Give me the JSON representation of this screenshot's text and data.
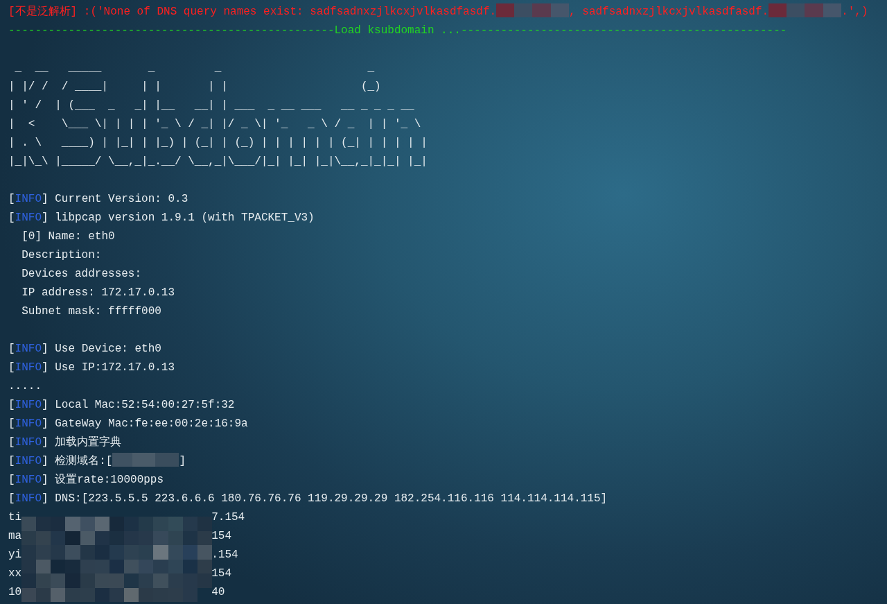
{
  "lines": [
    {
      "kind": "error",
      "segments": [
        {
          "kind": "text",
          "text": "[不是泛解析] :('None of DNS query names exist: sadfsadnxzjlkcxjvlkasdfasdf."
        },
        {
          "kind": "redaction"
        },
        {
          "kind": "text",
          "text": ", sadfsadnxzjlkcxjvlkasdfasdf."
        },
        {
          "kind": "redaction"
        },
        {
          "kind": "text",
          "text": ".',)"
        }
      ]
    },
    {
      "kind": "separator",
      "text": "-------------------------------------------------Load ksubdomain ...-------------------------------------------------"
    },
    {
      "kind": "blank"
    },
    {
      "kind": "ascii",
      "text": " _  __   _____       _         _                      _"
    },
    {
      "kind": "ascii",
      "text": "| |/ /  / ____|     | |       | |                    (_)"
    },
    {
      "kind": "ascii",
      "text": "| ' /  | (___  _   _| |__   __| | ___  _ __ ___   __ _ _ _ __"
    },
    {
      "kind": "ascii",
      "text": "|  <    \\___ \\| | | | '_ \\ / _| |/ _ \\| '_   _ \\ / _  | | '_ \\"
    },
    {
      "kind": "ascii",
      "text": "| . \\   ____) | |_| | |_) | (_| | (_) | | | | | | (_| | | | | |"
    },
    {
      "kind": "ascii",
      "text": "|_|\\_\\ |_____/ \\__,_|_.__/ \\__,_|\\___/|_| |_| |_|\\__,_|_|_| |_|"
    },
    {
      "kind": "blank"
    },
    {
      "kind": "info",
      "segments": [
        {
          "kind": "bracket",
          "text": "["
        },
        {
          "kind": "tag",
          "text": "INFO"
        },
        {
          "kind": "bracket",
          "text": "]"
        },
        {
          "kind": "text",
          "text": " Current Version: 0.3"
        }
      ]
    },
    {
      "kind": "info",
      "segments": [
        {
          "kind": "bracket",
          "text": "["
        },
        {
          "kind": "tag",
          "text": "INFO"
        },
        {
          "kind": "bracket",
          "text": "]"
        },
        {
          "kind": "text",
          "text": " libpcap version 1.9.1 (with TPACKET_V3)"
        }
      ]
    },
    {
      "kind": "plain",
      "text": "  [0] Name: eth0"
    },
    {
      "kind": "plain",
      "text": "  Description:"
    },
    {
      "kind": "plain",
      "text": "  Devices addresses:"
    },
    {
      "kind": "plain",
      "text": "  IP address: 172.17.0.13"
    },
    {
      "kind": "plain",
      "text": "  Subnet mask: fffff000"
    },
    {
      "kind": "blank"
    },
    {
      "kind": "info",
      "segments": [
        {
          "kind": "bracket",
          "text": "["
        },
        {
          "kind": "tag",
          "text": "INFO"
        },
        {
          "kind": "bracket",
          "text": "]"
        },
        {
          "kind": "text",
          "text": " Use Device: eth0"
        }
      ]
    },
    {
      "kind": "info",
      "segments": [
        {
          "kind": "bracket",
          "text": "["
        },
        {
          "kind": "tag",
          "text": "INFO"
        },
        {
          "kind": "bracket",
          "text": "]"
        },
        {
          "kind": "text",
          "text": " Use IP:172.17.0.13"
        }
      ]
    },
    {
      "kind": "plain",
      "text": "....."
    },
    {
      "kind": "info",
      "segments": [
        {
          "kind": "bracket",
          "text": "["
        },
        {
          "kind": "tag",
          "text": "INFO"
        },
        {
          "kind": "bracket",
          "text": "]"
        },
        {
          "kind": "text",
          "text": " Local Mac:52:54:00:27:5f:32"
        }
      ]
    },
    {
      "kind": "info",
      "segments": [
        {
          "kind": "bracket",
          "text": "["
        },
        {
          "kind": "tag",
          "text": "INFO"
        },
        {
          "kind": "bracket",
          "text": "]"
        },
        {
          "kind": "text",
          "text": " GateWay Mac:fe:ee:00:2e:16:9a"
        }
      ]
    },
    {
      "kind": "info",
      "segments": [
        {
          "kind": "bracket",
          "text": "["
        },
        {
          "kind": "tag",
          "text": "INFO"
        },
        {
          "kind": "bracket",
          "text": "]"
        },
        {
          "kind": "text",
          "text": " 加载内置字典"
        }
      ]
    },
    {
      "kind": "info",
      "segments": [
        {
          "kind": "bracket",
          "text": "["
        },
        {
          "kind": "tag",
          "text": "INFO"
        },
        {
          "kind": "bracket",
          "text": "]"
        },
        {
          "kind": "text",
          "text": " 检测域名:["
        },
        {
          "kind": "redaction"
        },
        {
          "kind": "text",
          "text": "]"
        }
      ]
    },
    {
      "kind": "info",
      "segments": [
        {
          "kind": "bracket",
          "text": "["
        },
        {
          "kind": "tag",
          "text": "INFO"
        },
        {
          "kind": "bracket",
          "text": "]"
        },
        {
          "kind": "text",
          "text": " 设置rate:10000pps"
        }
      ]
    },
    {
      "kind": "info",
      "segments": [
        {
          "kind": "bracket",
          "text": "["
        },
        {
          "kind": "tag",
          "text": "INFO"
        },
        {
          "kind": "bracket",
          "text": "]"
        },
        {
          "kind": "text",
          "text": " DNS:[223.5.5.5 223.6.6.6 180.76.76.76 119.29.29.29 182.254.116.116 114.114.114.115]"
        }
      ]
    }
  ],
  "masked_rows": [
    {
      "start": "ti",
      "end": "7.154"
    },
    {
      "start": "ma",
      "end": "154"
    },
    {
      "start": "yi",
      "end": ".154"
    },
    {
      "start": "xx",
      "end": "154"
    },
    {
      "start": "10",
      "end": "40"
    }
  ]
}
